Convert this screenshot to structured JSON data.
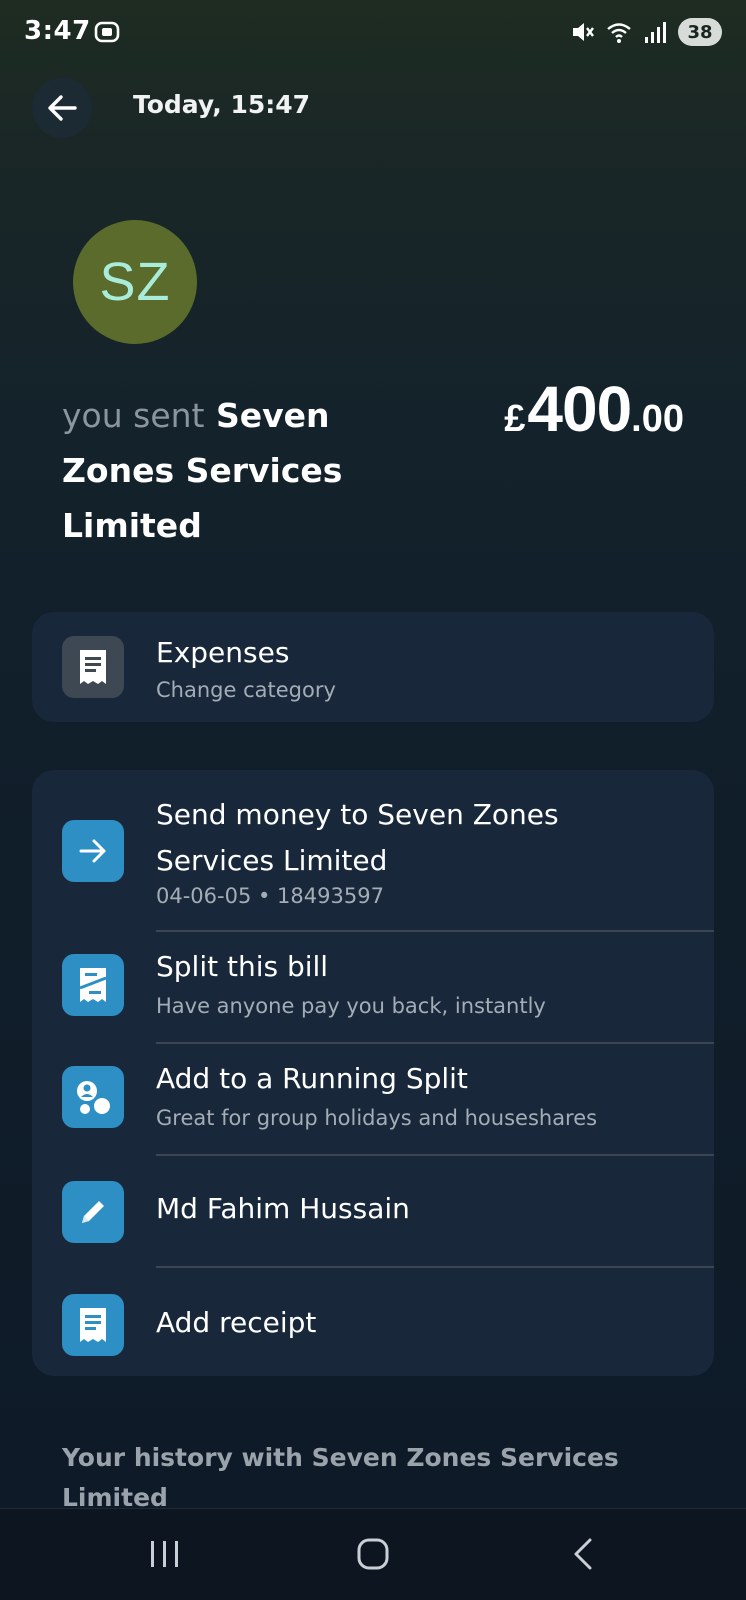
{
  "status_bar": {
    "time": "3:47",
    "battery": "38",
    "icons": [
      "screen-record-icon",
      "mute-icon",
      "wifi-icon",
      "signal-icon",
      "battery-icon"
    ]
  },
  "header": {
    "back_icon": "arrow-left-icon",
    "date": "Today, 15:47"
  },
  "avatar": {
    "initials": "SZ",
    "bg_color": "#5a6b2c",
    "text_color": "#a9ecd9"
  },
  "transaction": {
    "prefix": "you sent",
    "recipient": "Seven Zones Services Limited",
    "amount_currency": "£",
    "amount_main": "400",
    "amount_decimal": ".00"
  },
  "category": {
    "icon": "receipt-icon",
    "title": "Expenses",
    "subtitle": "Change category"
  },
  "actions": [
    {
      "icon": "arrow-right-icon",
      "title": "Send money to Seven Zones Services Limited",
      "subtitle": "04-06-05 • 18493597"
    },
    {
      "icon": "split-bill-icon",
      "title": "Split this bill",
      "subtitle": "Have anyone pay you back, instantly"
    },
    {
      "icon": "group-icon",
      "title": "Add to a Running Split",
      "subtitle": "Great for group holidays and houseshares"
    },
    {
      "icon": "pencil-icon",
      "title": "Md Fahim Hussain",
      "subtitle": ""
    },
    {
      "icon": "receipt-icon",
      "title": "Add receipt",
      "subtitle": ""
    }
  ],
  "history": {
    "title": "Your history with Seven Zones Services Limited"
  },
  "colors": {
    "accent_blue": "#2d8fc4",
    "card_bg": "#18283a"
  }
}
